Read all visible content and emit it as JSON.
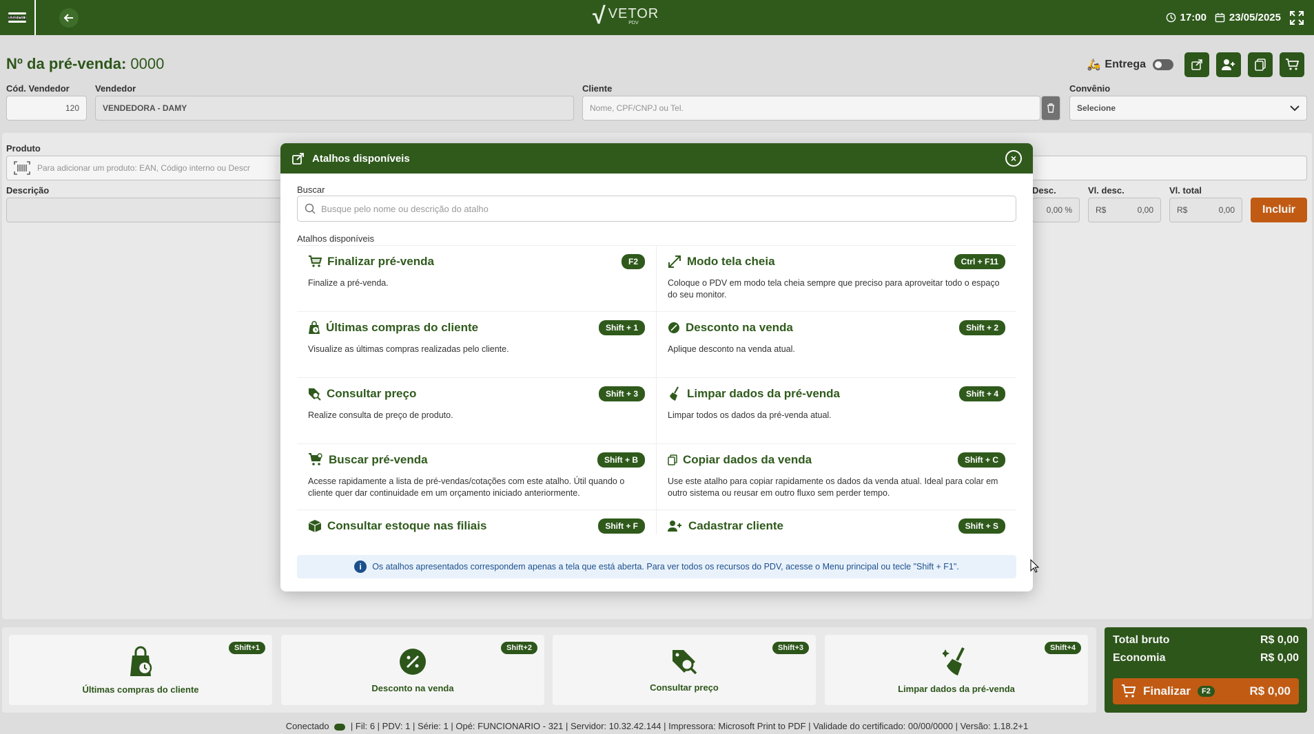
{
  "topbar": {
    "menu_label": "Menu",
    "logo_text": "VETOR",
    "logo_sub": "PDV",
    "time": "17:00",
    "date": "23/05/2025"
  },
  "header": {
    "title_prefix": "Nº da pré-venda:",
    "title_number": "0000",
    "entrega_label": "Entrega"
  },
  "form": {
    "cod_vendedor_label": "Cód. Vendedor",
    "cod_vendedor_value": "120",
    "vendedor_label": "Vendedor",
    "vendedor_value": "VENDEDORA - DAMY",
    "cliente_label": "Cliente",
    "cliente_placeholder": "Nome, CPF/CNPJ ou Tel.",
    "convenio_label": "Convênio",
    "convenio_value": "Selecione",
    "produto_label": "Produto",
    "produto_placeholder": "Para adicionar um produto: EAN, Código interno ou Descr",
    "descricao_label": "Descrição",
    "desc_label": "Desc.",
    "desc_value": "0,00 %",
    "vl_desc_label": "Vl. desc.",
    "vl_desc_prefix": "R$",
    "vl_desc_value": "0,00",
    "vl_total_label": "Vl. total",
    "vl_total_prefix": "R$",
    "vl_total_value": "0,00",
    "incluir_label": "Incluir"
  },
  "modal": {
    "title": "Atalhos disponíveis",
    "search_label": "Buscar",
    "search_placeholder": "Busque pelo nome ou descrição do atalho",
    "list_label": "Atalhos disponíveis",
    "shortcuts": [
      {
        "title": "Finalizar pré-venda",
        "key": "F2",
        "desc": "Finalize a pré-venda.",
        "icon": "cart-icon"
      },
      {
        "title": "Modo tela cheia",
        "key": "Ctrl + F11",
        "desc": "Coloque o PDV em modo tela cheia sempre que preciso para aproveitar todo o espaço do seu monitor.",
        "icon": "expand-icon"
      },
      {
        "title": "Últimas compras do cliente",
        "key": "Shift + 1",
        "desc": "Visualize as últimas compras realizadas pelo cliente.",
        "icon": "bag-clock-icon"
      },
      {
        "title": "Desconto na venda",
        "key": "Shift + 2",
        "desc": "Aplique desconto na venda atual.",
        "icon": "discount-icon"
      },
      {
        "title": "Consultar preço",
        "key": "Shift + 3",
        "desc": "Realize consulta de preço de produto.",
        "icon": "price-tag-search-icon"
      },
      {
        "title": "Limpar dados da pré-venda",
        "key": "Shift + 4",
        "desc": "Limpar todos os dados da pré-venda atual.",
        "icon": "broom-icon"
      },
      {
        "title": "Buscar pré-venda",
        "key": "Shift + B",
        "desc": "Acesse rapidamente a lista de pré-vendas/cotações com este atalho. Útil quando o cliente quer dar continuidade em um orçamento iniciado anteriormente.",
        "icon": "cart-search-icon"
      },
      {
        "title": "Copiar dados da venda",
        "key": "Shift + C",
        "desc": "Use este atalho para copiar rapidamente os dados da venda atual. Ideal para colar em outro sistema ou reusar em outro fluxo sem perder tempo.",
        "icon": "copy-icon"
      },
      {
        "title": "Consultar estoque nas filiais",
        "key": "Shift + F",
        "desc": "",
        "icon": "boxes-icon"
      },
      {
        "title": "Cadastrar cliente",
        "key": "Shift + S",
        "desc": "",
        "icon": "user-plus-icon"
      }
    ],
    "info_text": "Os atalhos apresentados correspondem apenas a tela que está aberta. Para ver todos os recursos do PDV, acesse o Menu principal ou tecle \"Shift + F1\"."
  },
  "bottom_cards": [
    {
      "label": "Últimas compras do cliente",
      "key": "Shift+1"
    },
    {
      "label": "Desconto na venda",
      "key": "Shift+2"
    },
    {
      "label": "Consultar preço",
      "key": "Shift+3"
    },
    {
      "label": "Limpar dados da pré-venda",
      "key": "Shift+4"
    }
  ],
  "totals": {
    "bruto_label": "Total bruto",
    "bruto_value": "R$ 0,00",
    "economia_label": "Economia",
    "economia_value": "R$ 0,00",
    "finalizar_label": "Finalizar",
    "finalizar_key": "F2",
    "finalizar_value": "R$ 0,00"
  },
  "status": {
    "conectado": "Conectado",
    "details": "| Fil: 6 | PDV: 1 | Série: 1 | Opé: FUNCIONARIO - 321 | Servidor: 10.32.42.144 | Impressora: Microsoft Print to PDF | Validade do certificado: 00/00/0000 | Versão: 1.18.2+1"
  },
  "colors": {
    "brand_green": "#2f5a1c",
    "accent_orange": "#c95f14",
    "info_blue": "#1d4f8c"
  }
}
